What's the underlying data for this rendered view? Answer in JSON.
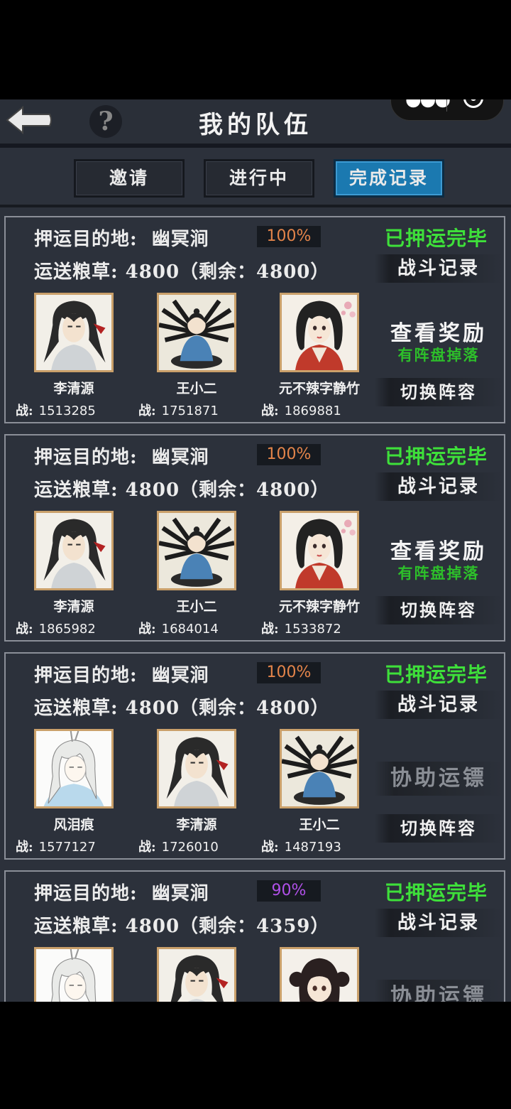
{
  "header": {
    "title": "我的队伍",
    "menu_capsule": {
      "more_icon": "more-dots-icon",
      "close_icon": "target-icon"
    }
  },
  "tabs": [
    {
      "label": "邀请",
      "active": false
    },
    {
      "label": "进行中",
      "active": false
    },
    {
      "label": "完成记录",
      "active": true
    }
  ],
  "labels": {
    "destination_prefix": "押运目的地:",
    "cargo_prefix": "运送粮草:",
    "power_prefix": "战:",
    "battle_record": "战斗记录",
    "view_reward": "查看奖励",
    "reward_note": "有阵盘掉落",
    "switch_lineup": "切换阵容",
    "assist_escort": "协助运镖"
  },
  "cards": [
    {
      "destination": "幽冥涧",
      "progress": "100%",
      "status": "已押运完毕",
      "cargo": "4800（剩余：4800）",
      "members": [
        {
          "name": "李清源",
          "power": "1513285",
          "portrait": "swordsman-portrait"
        },
        {
          "name": "王小二",
          "power": "1751871",
          "portrait": "meditating-boy-portrait"
        },
        {
          "name": "元不辣字静竹",
          "power": "1869881",
          "portrait": "lady-portrait"
        }
      ],
      "action": "reward"
    },
    {
      "destination": "幽冥涧",
      "progress": "100%",
      "status": "已押运完毕",
      "cargo": "4800（剩余：4800）",
      "members": [
        {
          "name": "李清源",
          "power": "1865982",
          "portrait": "swordsman-portrait"
        },
        {
          "name": "王小二",
          "power": "1684014",
          "portrait": "meditating-boy-portrait"
        },
        {
          "name": "元不辣字静竹",
          "power": "1533872",
          "portrait": "lady-portrait"
        }
      ],
      "action": "reward"
    },
    {
      "destination": "幽冥涧",
      "progress": "100%",
      "status": "已押运完毕",
      "cargo": "4800（剩余：4800）",
      "members": [
        {
          "name": "风泪痕",
          "power": "1577127",
          "portrait": "white-hair-portrait"
        },
        {
          "name": "李清源",
          "power": "1726010",
          "portrait": "swordsman-portrait"
        },
        {
          "name": "王小二",
          "power": "1487193",
          "portrait": "meditating-boy-portrait"
        }
      ],
      "action": "assist"
    },
    {
      "destination": "幽冥涧",
      "progress": "90%",
      "status": "已押运完毕",
      "cargo": "4800（剩余：4359）",
      "members": [
        {
          "name": "",
          "power": "",
          "portrait": "white-hair-portrait"
        },
        {
          "name": "",
          "power": "",
          "portrait": "swordsman-portrait"
        },
        {
          "name": "",
          "power": "",
          "portrait": "bun-girl-portrait"
        }
      ],
      "action": "assist"
    }
  ],
  "colors": {
    "complete_status": "#3ee03a",
    "progress_full": "#e3844a",
    "progress_partial": "#b050e8",
    "active_tab": "#1b79b0",
    "portrait_frame": "#caa06a"
  }
}
